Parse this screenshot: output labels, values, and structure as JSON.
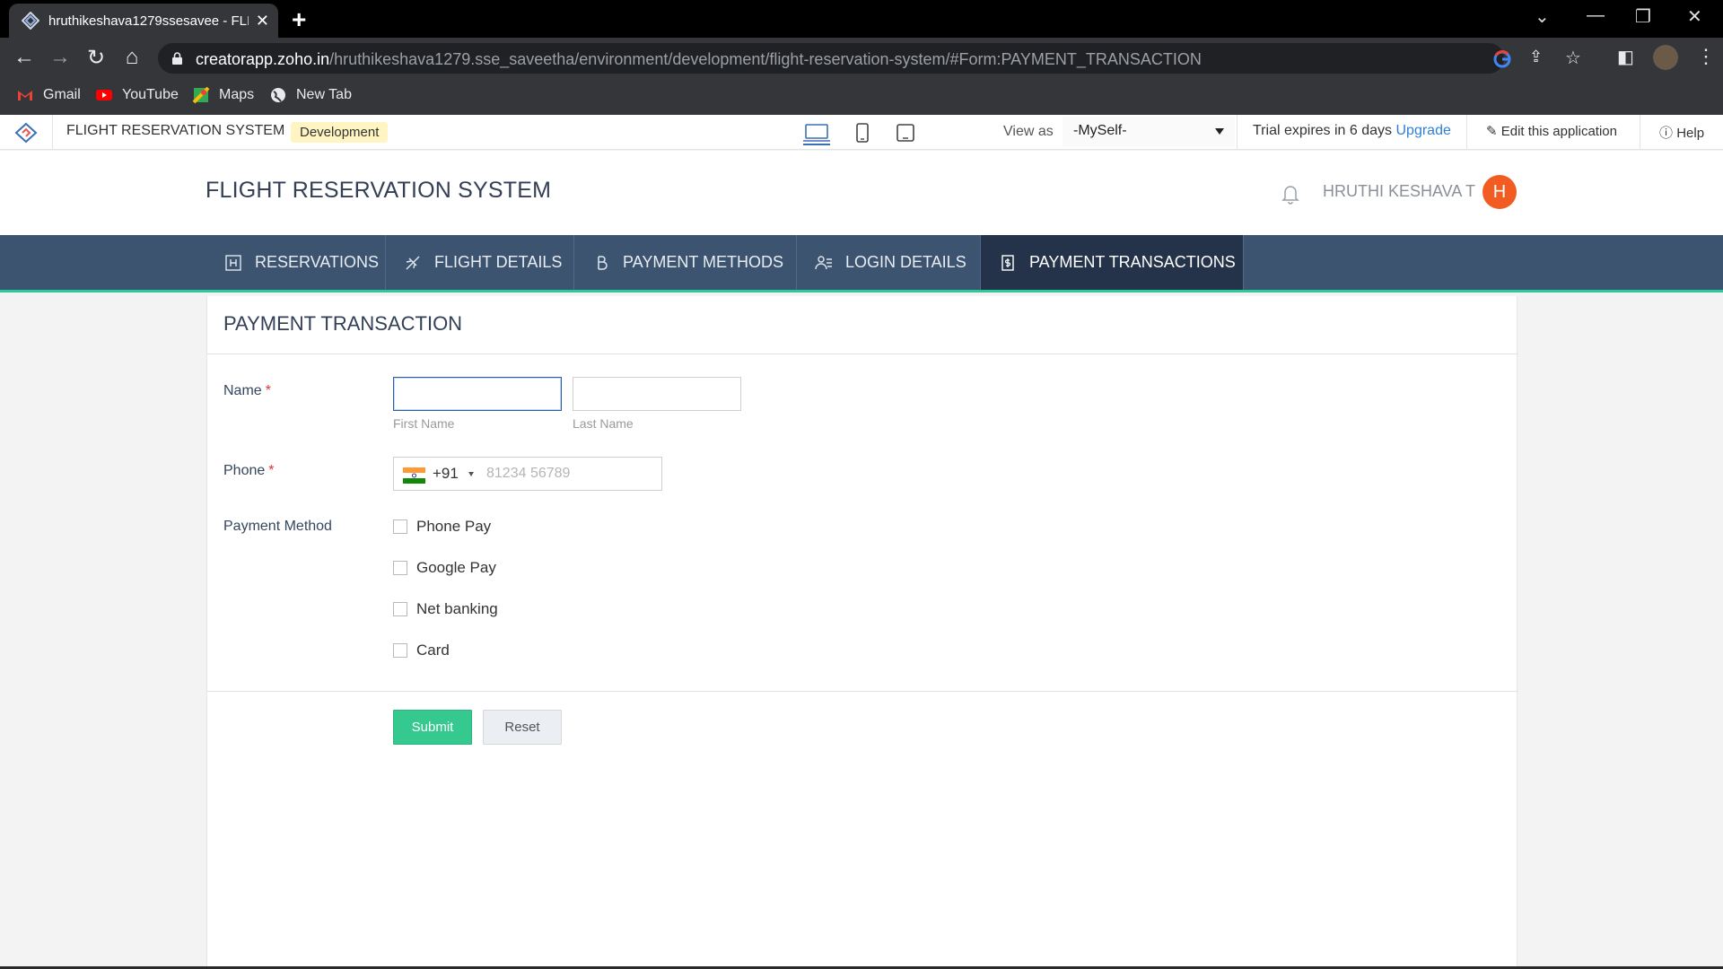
{
  "browser": {
    "tab_title": "hruthikeshava1279ssesavee - FLIGHT RESERVATION SYSTEM",
    "tab_close": "✕",
    "new_tab": "+",
    "url_host": "creatorapp.zoho.in",
    "url_path": "/hruthikeshava1279.sse_saveetha/environment/development/flight-reservation-system/#Form:PAYMENT_TRANSACTION",
    "bookmarks": [
      "Gmail",
      "YouTube",
      "Maps",
      "New Tab"
    ]
  },
  "devbar": {
    "app_name": "FLIGHT RESERVATION SYSTEM",
    "env_badge": "Development",
    "view_as_label": "View as",
    "view_as_value": "-MySelf-",
    "trial_prefix": "Trial expires in ",
    "trial_days": "6 days",
    "upgrade": "Upgrade",
    "edit_app": "Edit this application",
    "help": "Help"
  },
  "header": {
    "app_title": "FLIGHT RESERVATION SYSTEM",
    "user_name": "HRUTHI KESHAVA T",
    "avatar_initial": "H"
  },
  "nav": {
    "items": [
      {
        "label": "RESERVATIONS",
        "icon": "reservations-icon"
      },
      {
        "label": "FLIGHT DETAILS",
        "icon": "flight-icon"
      },
      {
        "label": "PAYMENT METHODS",
        "icon": "bitcoin-icon"
      },
      {
        "label": "LOGIN DETAILS",
        "icon": "users-icon"
      },
      {
        "label": "PAYMENT TRANSACTIONS",
        "icon": "dollar-doc-icon",
        "active": true
      }
    ]
  },
  "form": {
    "title": "PAYMENT TRANSACTION",
    "name_label": "Name",
    "required_mark": "*",
    "first_name_value": "",
    "first_name_hint": "First Name",
    "last_name_value": "",
    "last_name_hint": "Last Name",
    "phone_label": "Phone",
    "country_code": "+91",
    "phone_placeholder": "81234 56789",
    "payment_method_label": "Payment Method",
    "payment_options": [
      "Phone Pay",
      "Google Pay",
      "Net banking",
      "Card"
    ],
    "submit": "Submit",
    "reset": "Reset"
  },
  "colors": {
    "nav_bg": "#3d5470",
    "nav_active": "#24334a",
    "accent_green": "#36c98f",
    "avatar": "#f25c22",
    "link_blue": "#2f7fd5"
  }
}
